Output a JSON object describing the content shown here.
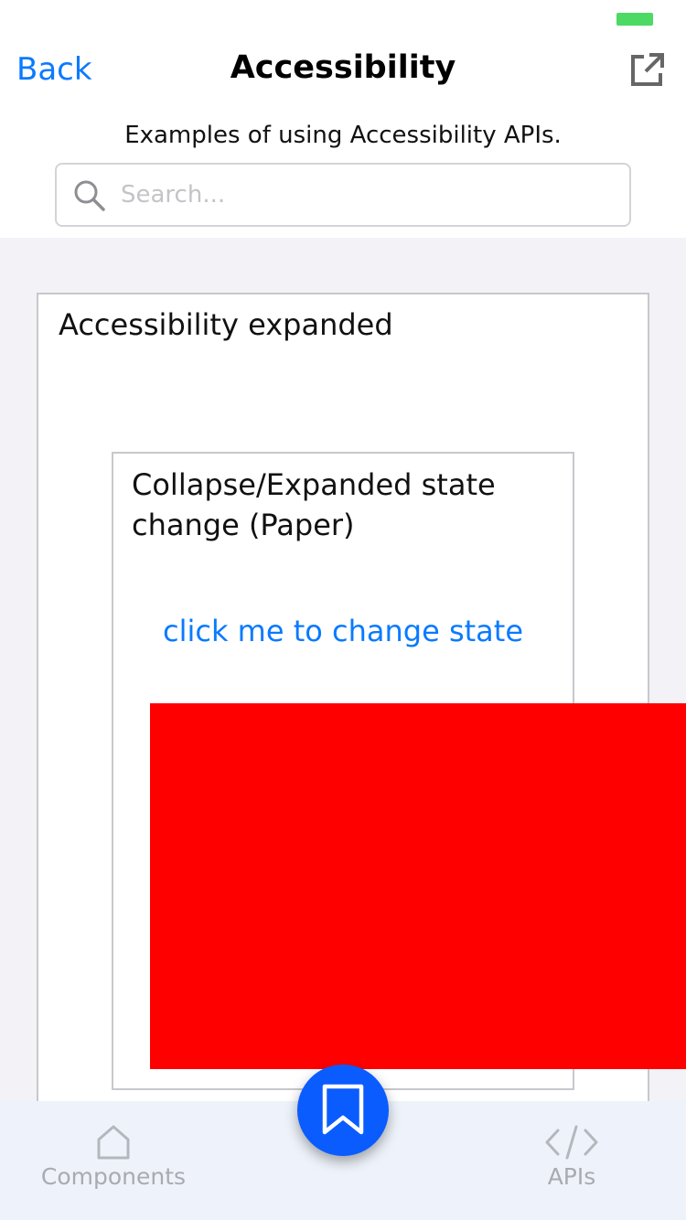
{
  "header": {
    "back_label": "Back",
    "title": "Accessibility",
    "subtitle": "Examples of using Accessibility APIs.",
    "open_external_icon": "open-in-new-icon"
  },
  "search": {
    "placeholder": "Search...",
    "value": ""
  },
  "content": {
    "outer_card_title": "Accessibility expanded",
    "inner_card_title": "Collapse/Expanded state change (Paper)",
    "change_state_link": "click me to change state"
  },
  "colors": {
    "accent": "#0a7aff",
    "fab": "#0a5cff",
    "overlay_block": "#ff0000",
    "battery": "#4cd964"
  },
  "tabbar": {
    "tabs": [
      {
        "label": "Components",
        "icon": "home-icon"
      },
      {
        "label": "APIs",
        "icon": "code-icon"
      }
    ],
    "fab_icon": "bookmark-icon"
  }
}
